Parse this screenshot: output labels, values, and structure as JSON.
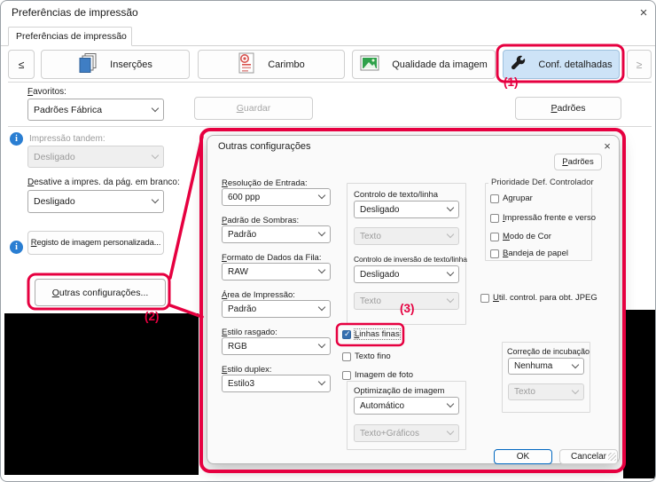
{
  "colors": {
    "annotation_red": "#e60040",
    "active_tab_button_blue": "#cde3f7",
    "checkbox_checked_blue": "#356fb0",
    "info_icon_blue": "#2a7ed2",
    "redacted_black": "#000000"
  },
  "window": {
    "title": "Preferências de impressão",
    "tab": "Preferências de impressão",
    "close_glyph": "×"
  },
  "toolbar": {
    "prev": "≤",
    "next": "≥",
    "insercoes": "Inserções",
    "carimbo": "Carimbo",
    "qualidade": "Qualidade da imagem",
    "conf": "Conf. detalhadas"
  },
  "left": {
    "favoritos_label": "Favoritos:",
    "favoritos_value": "Padrões Fábrica",
    "guardar": "Guardar",
    "padroes": "Padrões",
    "tandem_label": "Impressão tandem:",
    "tandem_value": "Desligado",
    "blank_label": "Desative a impres. da pág. em branco:",
    "blank_value": "Desligado",
    "registo": "Registo de imagem personalizada...",
    "outras": "Outras configurações..."
  },
  "ann": {
    "n1": "(1)",
    "n2": "(2)",
    "n3": "(3)"
  },
  "dlg": {
    "title": "Outras configurações",
    "close_glyph": "×",
    "padroes": "Padrões",
    "col1": [
      {
        "label": "Resolução de Entrada:",
        "value": "600 ppp"
      },
      {
        "label": "Padrão de Sombras:",
        "value": "Padrão"
      },
      {
        "label": "Formato de Dados da Fila:",
        "value": "RAW"
      },
      {
        "label": "Área de Impressão:",
        "value": "Padrão"
      },
      {
        "label": "Estilo rasgado:",
        "value": "RGB"
      },
      {
        "label": "Estilo duplex:",
        "value": "Estilo3"
      }
    ],
    "ctl_texto": {
      "label": "Controlo de texto/linha",
      "value": "Desligado",
      "sub": "Texto"
    },
    "ctl_inv": {
      "label": "Controlo de inversão de texto/linha",
      "value": "Desligado",
      "sub": "Texto"
    },
    "chk_linhas": {
      "label": "Linhas finas",
      "checked": true
    },
    "chk_texto": {
      "label": "Texto fino",
      "checked": false
    },
    "chk_foto": {
      "label": "Imagem de foto",
      "checked": false
    },
    "opt": {
      "label": "Optimização de imagem",
      "value": "Automático",
      "sub": "Texto+Gráficos"
    },
    "prio": {
      "label": "Prioridade Def. Controlador",
      "items": [
        "Agrupar",
        "Impressão frente e verso",
        "Modo de Cor",
        "Bandeja de papel"
      ],
      "checked": [
        false,
        false,
        false,
        false
      ]
    },
    "jpeg": {
      "label": "Util. control. para obt. JPEG",
      "checked": false
    },
    "half": {
      "label": "Correção de incubação",
      "value": "Nenhuma",
      "sub": "Texto"
    },
    "ok": "OK",
    "cancel": "Cancelar"
  },
  "icons": {
    "insercoes": "stacked-pages-icon",
    "carimbo": "stamp-document-icon",
    "qualidade": "photo-image-icon",
    "conf": "wrench-icon",
    "info": "info-circle-icon"
  }
}
